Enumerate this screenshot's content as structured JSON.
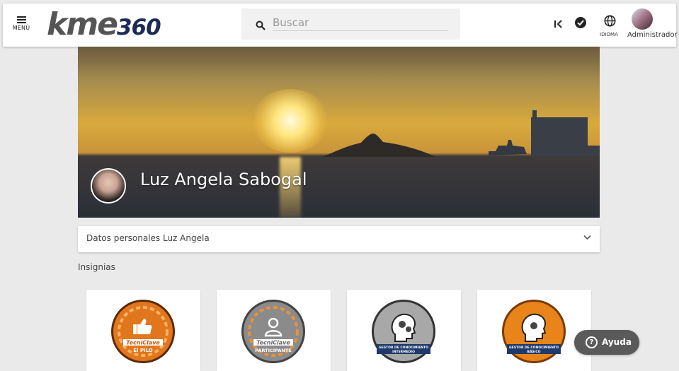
{
  "topbar": {
    "menu_label": "MENÚ",
    "logo_text": "kme",
    "logo_number": "360",
    "search_placeholder": "Buscar",
    "language_label": "IDIOMA",
    "user_label": "Administrador"
  },
  "profile": {
    "name": "Luz Angela Sabogal"
  },
  "accordion": {
    "title": "Datos personales Luz Angela"
  },
  "badges_section": {
    "title": "Insignias",
    "items": [
      {
        "brand": "TecniClave",
        "label": "El PILO",
        "color": "#e2761c",
        "icon": "thumbs-up-icon"
      },
      {
        "brand": "TecniClave",
        "label": "PARTICIPANTE",
        "color": "#8b8b8b",
        "icon": "person-icon"
      },
      {
        "brand": "GESTOR DE CONOCIMIENTO",
        "label": "INTERMEDIO",
        "color": "#9a9a9a",
        "icon": "head-gears-icon"
      },
      {
        "brand": "GESTOR DE CONOCIMIENTO",
        "label": "BÁSICO",
        "color": "#e8841a",
        "icon": "head-gear-icon"
      }
    ]
  },
  "help": {
    "label": "Ayuda"
  },
  "colors": {
    "topbar_bg": "#ffffff",
    "page_bg": "#eaeaea",
    "logo_accent": "#1c2a55",
    "help_bg": "#5a5a5a"
  }
}
